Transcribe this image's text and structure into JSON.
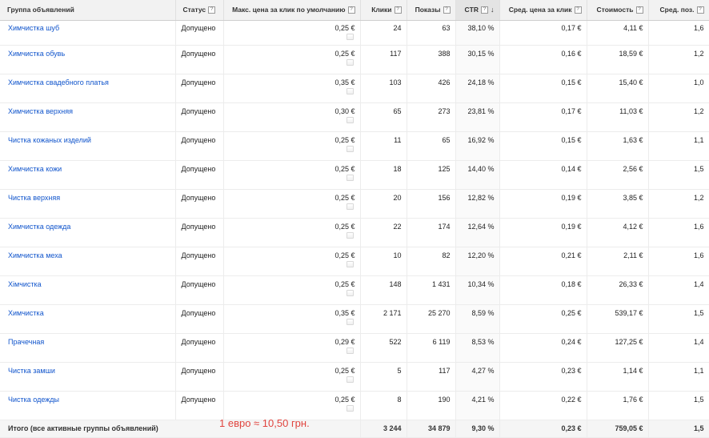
{
  "header": {
    "ad_group": "Группа объявлений",
    "status": "Статус",
    "max_cpc": "Макс. цена за клик по умолчанию",
    "clicks": "Клики",
    "impressions": "Показы",
    "ctr": "CTR",
    "avg_cpc": "Сред. цена за клик",
    "cost": "Стоимость",
    "avg_pos": "Сред. поз.",
    "help_glyph": "?",
    "sort_arrow": "↓"
  },
  "rows": [
    {
      "name": "Химчистка шуб",
      "status": "Допущено",
      "bid": "0,25 €",
      "clicks": "24",
      "impr": "63",
      "ctr": "38,10 %",
      "avg_cpc": "0,17 €",
      "cost": "4,11 €",
      "pos": "1,6"
    },
    {
      "name": "Химчистка обувь",
      "status": "Допущено",
      "bid": "0,25 €",
      "clicks": "117",
      "impr": "388",
      "ctr": "30,15 %",
      "avg_cpc": "0,16 €",
      "cost": "18,59 €",
      "pos": "1,2"
    },
    {
      "name": "Химчистка свадебного платья",
      "status": "Допущено",
      "bid": "0,35 €",
      "clicks": "103",
      "impr": "426",
      "ctr": "24,18 %",
      "avg_cpc": "0,15 €",
      "cost": "15,40 €",
      "pos": "1,0"
    },
    {
      "name": "Химчистка верхняя",
      "status": "Допущено",
      "bid": "0,30 €",
      "clicks": "65",
      "impr": "273",
      "ctr": "23,81 %",
      "avg_cpc": "0,17 €",
      "cost": "11,03 €",
      "pos": "1,2"
    },
    {
      "name": "Чистка кожаных изделий",
      "status": "Допущено",
      "bid": "0,25 €",
      "clicks": "11",
      "impr": "65",
      "ctr": "16,92 %",
      "avg_cpc": "0,15 €",
      "cost": "1,63 €",
      "pos": "1,1"
    },
    {
      "name": "Химчистка кожи",
      "status": "Допущено",
      "bid": "0,25 €",
      "clicks": "18",
      "impr": "125",
      "ctr": "14,40 %",
      "avg_cpc": "0,14 €",
      "cost": "2,56 €",
      "pos": "1,5"
    },
    {
      "name": "Чистка верхняя",
      "status": "Допущено",
      "bid": "0,25 €",
      "clicks": "20",
      "impr": "156",
      "ctr": "12,82 %",
      "avg_cpc": "0,19 €",
      "cost": "3,85 €",
      "pos": "1,2"
    },
    {
      "name": "Химчистка одежда",
      "status": "Допущено",
      "bid": "0,25 €",
      "clicks": "22",
      "impr": "174",
      "ctr": "12,64 %",
      "avg_cpc": "0,19 €",
      "cost": "4,12 €",
      "pos": "1,6"
    },
    {
      "name": "Химчистка меха",
      "status": "Допущено",
      "bid": "0,25 €",
      "clicks": "10",
      "impr": "82",
      "ctr": "12,20 %",
      "avg_cpc": "0,21 €",
      "cost": "2,11 €",
      "pos": "1,6"
    },
    {
      "name": "Хімчистка",
      "status": "Допущено",
      "bid": "0,25 €",
      "clicks": "148",
      "impr": "1 431",
      "ctr": "10,34 %",
      "avg_cpc": "0,18 €",
      "cost": "26,33 €",
      "pos": "1,4"
    },
    {
      "name": "Химчистка",
      "status": "Допущено",
      "bid": "0,35 €",
      "clicks": "2 171",
      "impr": "25 270",
      "ctr": "8,59 %",
      "avg_cpc": "0,25 €",
      "cost": "539,17 €",
      "pos": "1,5"
    },
    {
      "name": "Прачечная",
      "status": "Допущено",
      "bid": "0,29 €",
      "clicks": "522",
      "impr": "6 119",
      "ctr": "8,53 %",
      "avg_cpc": "0,24 €",
      "cost": "127,25 €",
      "pos": "1,4"
    },
    {
      "name": "Чистка замши",
      "status": "Допущено",
      "bid": "0,25 €",
      "clicks": "5",
      "impr": "117",
      "ctr": "4,27 %",
      "avg_cpc": "0,23 €",
      "cost": "1,14 €",
      "pos": "1,1"
    },
    {
      "name": "Чистка одежды",
      "status": "Допущено",
      "bid": "0,25 €",
      "clicks": "8",
      "impr": "190",
      "ctr": "4,21 %",
      "avg_cpc": "0,22 €",
      "cost": "1,76 €",
      "pos": "1,5"
    }
  ],
  "total": {
    "label": "Итого (все активные группы объявлений)",
    "clicks": "3 244",
    "impr": "34 879",
    "ctr": "9,30 %",
    "avg_cpc": "0,23 €",
    "cost": "759,05 €",
    "pos": "1,5"
  },
  "annotation": "1 евро ≈ 10,50 грн."
}
